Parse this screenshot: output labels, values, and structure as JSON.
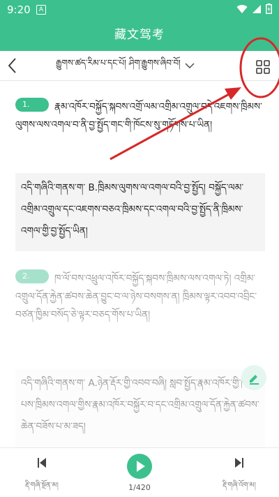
{
  "status": {
    "time": "9:20",
    "notif": "A"
  },
  "app": {
    "title": "藏文驾考"
  },
  "toolbar": {
    "chapter": "རྒྱུགས་ཚད་རིམ་པ་དང་པོ། ཤིག་རྒྱུགས་ཞིབ་བོ།"
  },
  "questions": [
    {
      "number": "1.",
      "text": "རྣམ་འཁོར་བསྐྱོད་སྐབས་འགྲོ་ལམ་འགྲིམ་འགྲུལ་བདེ་འཇགས་ཁྲིམས་ལུགས་ལས་འགལ་བ་ནི་བྱ་སྤྱོད་གང་གི་ཁོངས་སུ་གཏོགས་པ་ཡིན།",
      "answer": "འདི་གཞིའི་གནས་ག་ B.ཁྲིམས་ལུགས་ལ་འགལ་བའི་བྱ་སྤྱོད། བསྐྱོད་ལམ་འགྲིམ་འགྲུལ་དང་འཇགས་བཅའ་ཁྲིམས་དང་འགལ་བའི་བྱ་སྤྱོད་ནི་ཁྲིམས་འགལ་གྱི་བྱ་སྤྱོད་ཡིན།"
    },
    {
      "number": "2.",
      "text": "ཁ་ལོ་བས་འཕྲུལ་འཁོར་བསྐྱོད་སྐབས་ཁྲིམས་ལས་འགལ་ཏེ། འགྲིམ་འགྲུལ་དོན་རྐྱེན་ཚབས་ཆེན་བྱུང་བ་ལ་ཉེས་བསགས་ན། ཁྲིམས་ལྟར་འབབ་འབྲིང་བཙན་ཁྱིམ་བསོད་ཅེ་ལྟར་བཅད་གོས་པ་ཡིན།",
      "answer": "འདི་གཞིའི་གནས་ག་ A.ཉེན་རྡོར་གྱི་འབབ་བཞི། སླབ་སྤྱོད་རྣམ་འཁོར་གྱི་ཁ་ལོ་པས་ཁྲིམས་འགལ་གྱིས་རྣམ་འཁོར་བསྐྱོར་བ་དང་འགྲིམ་འགྲུལ་དོན་རྐྱེན་ཚབས་ཆེན་བཟོས་པ་མ་ཟད།"
    }
  ],
  "footer": {
    "prev_label": "རྡི་གཞི་སྔོན་མ།",
    "next_label": "རྡི་གཞི་འོག་མ།",
    "page": "1/420"
  },
  "colors": {
    "accent": "#3cc08e",
    "annotation": "#d62828"
  }
}
